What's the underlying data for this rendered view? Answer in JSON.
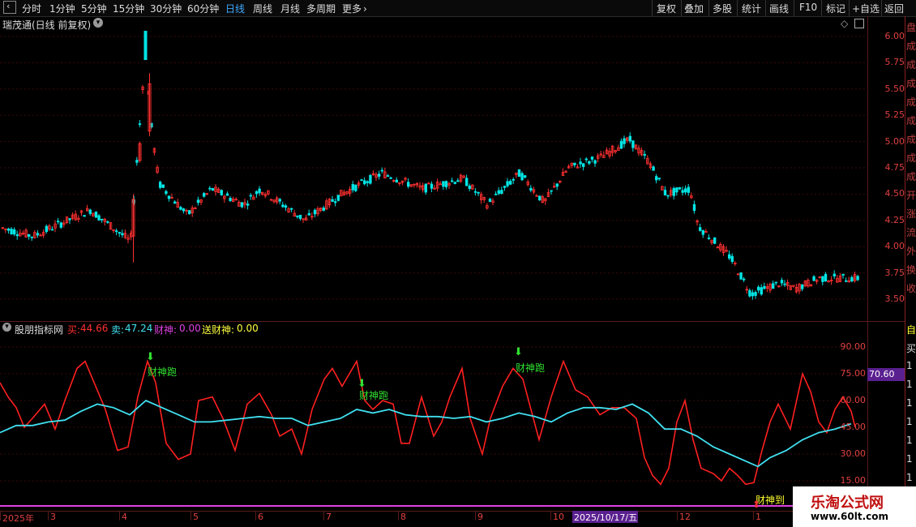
{
  "toolbar": {
    "back_icon": "chevron-left-icon",
    "periods": [
      "分时",
      "1分钟",
      "5分钟",
      "15分钟",
      "30分钟",
      "60分钟",
      "日线",
      "周线",
      "月线",
      "多周期",
      "更多"
    ],
    "active_period": "日线",
    "more_icon": "chevron-right-icon",
    "actions": [
      "复权",
      "叠加",
      "多股",
      "统计",
      "画线",
      "F10",
      "标记",
      "+自选",
      "返回"
    ]
  },
  "main_chart": {
    "title": "瑞茂通(日线 前复权)",
    "dropdown_icon": "chevron-down-circle-icon",
    "diamond_icon": "diamond-icon",
    "menu_icon": "square-menu-icon",
    "y_ticks": [
      "6.00",
      "5.75",
      "5.50",
      "5.25",
      "5.00",
      "4.75",
      "4.50",
      "4.25",
      "4.00",
      "3.75",
      "3.50"
    ],
    "colors": {
      "up": "#ff3030",
      "down": "#00e5e5"
    }
  },
  "indicator": {
    "name": "股朋指标网",
    "buy_label": "买:",
    "buy_value": "44.66",
    "sell_label": "卖:",
    "sell_value": "47.24",
    "caishen_label": "财神:",
    "caishen_value": "0.00",
    "song_label": "送财神:",
    "song_value": "0.00",
    "y_ticks": [
      "90.00",
      "75.00",
      "60.00",
      "45.00",
      "30.00",
      "15.00"
    ],
    "current_value": "70.60",
    "annotations": [
      "财神跑",
      "财神跑",
      "财神跑",
      "财神到"
    ],
    "colors": {
      "buy": "#ff2020",
      "sell": "#40e0f0",
      "caishen": "#e040e0",
      "song": "#ffff40"
    }
  },
  "date_axis": {
    "labels": [
      "2025年",
      "3",
      "4",
      "5",
      "6",
      "7",
      "8",
      "9",
      "10",
      "12",
      "1"
    ],
    "cursor_date": "2025/10/17/五"
  },
  "right_panel": {
    "chars_top": [
      "盘",
      "成",
      "成",
      "成",
      "成",
      "成",
      "成",
      "成",
      "成",
      "开",
      "涨",
      "流",
      "外",
      "换",
      "收"
    ],
    "chars_bottom": [
      "自",
      "买",
      "1",
      "1",
      "1",
      "1",
      "1",
      "1",
      "1"
    ]
  },
  "watermark": {
    "title": "乐淘公式网",
    "url": "www.60lt.com"
  }
}
